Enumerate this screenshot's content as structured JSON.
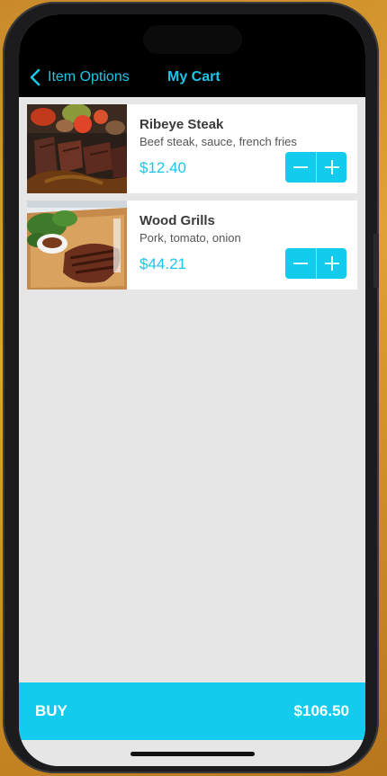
{
  "nav": {
    "back_label": "Item Options",
    "title": "My Cart"
  },
  "cart": {
    "items": [
      {
        "name": "Ribeye Steak",
        "description": "Beef steak, sauce, french fries",
        "price": "$12.40",
        "image": "ribeye-steak-photo"
      },
      {
        "name": "Wood Grills",
        "description": "Pork, tomato, onion",
        "price": "$44.21",
        "image": "wood-grills-photo"
      }
    ]
  },
  "footer": {
    "buy_label": "BUY",
    "total": "$106.50"
  },
  "colors": {
    "accent": "#12cbed",
    "accent_text": "#19c6ea",
    "background": "#e6e6e6"
  }
}
